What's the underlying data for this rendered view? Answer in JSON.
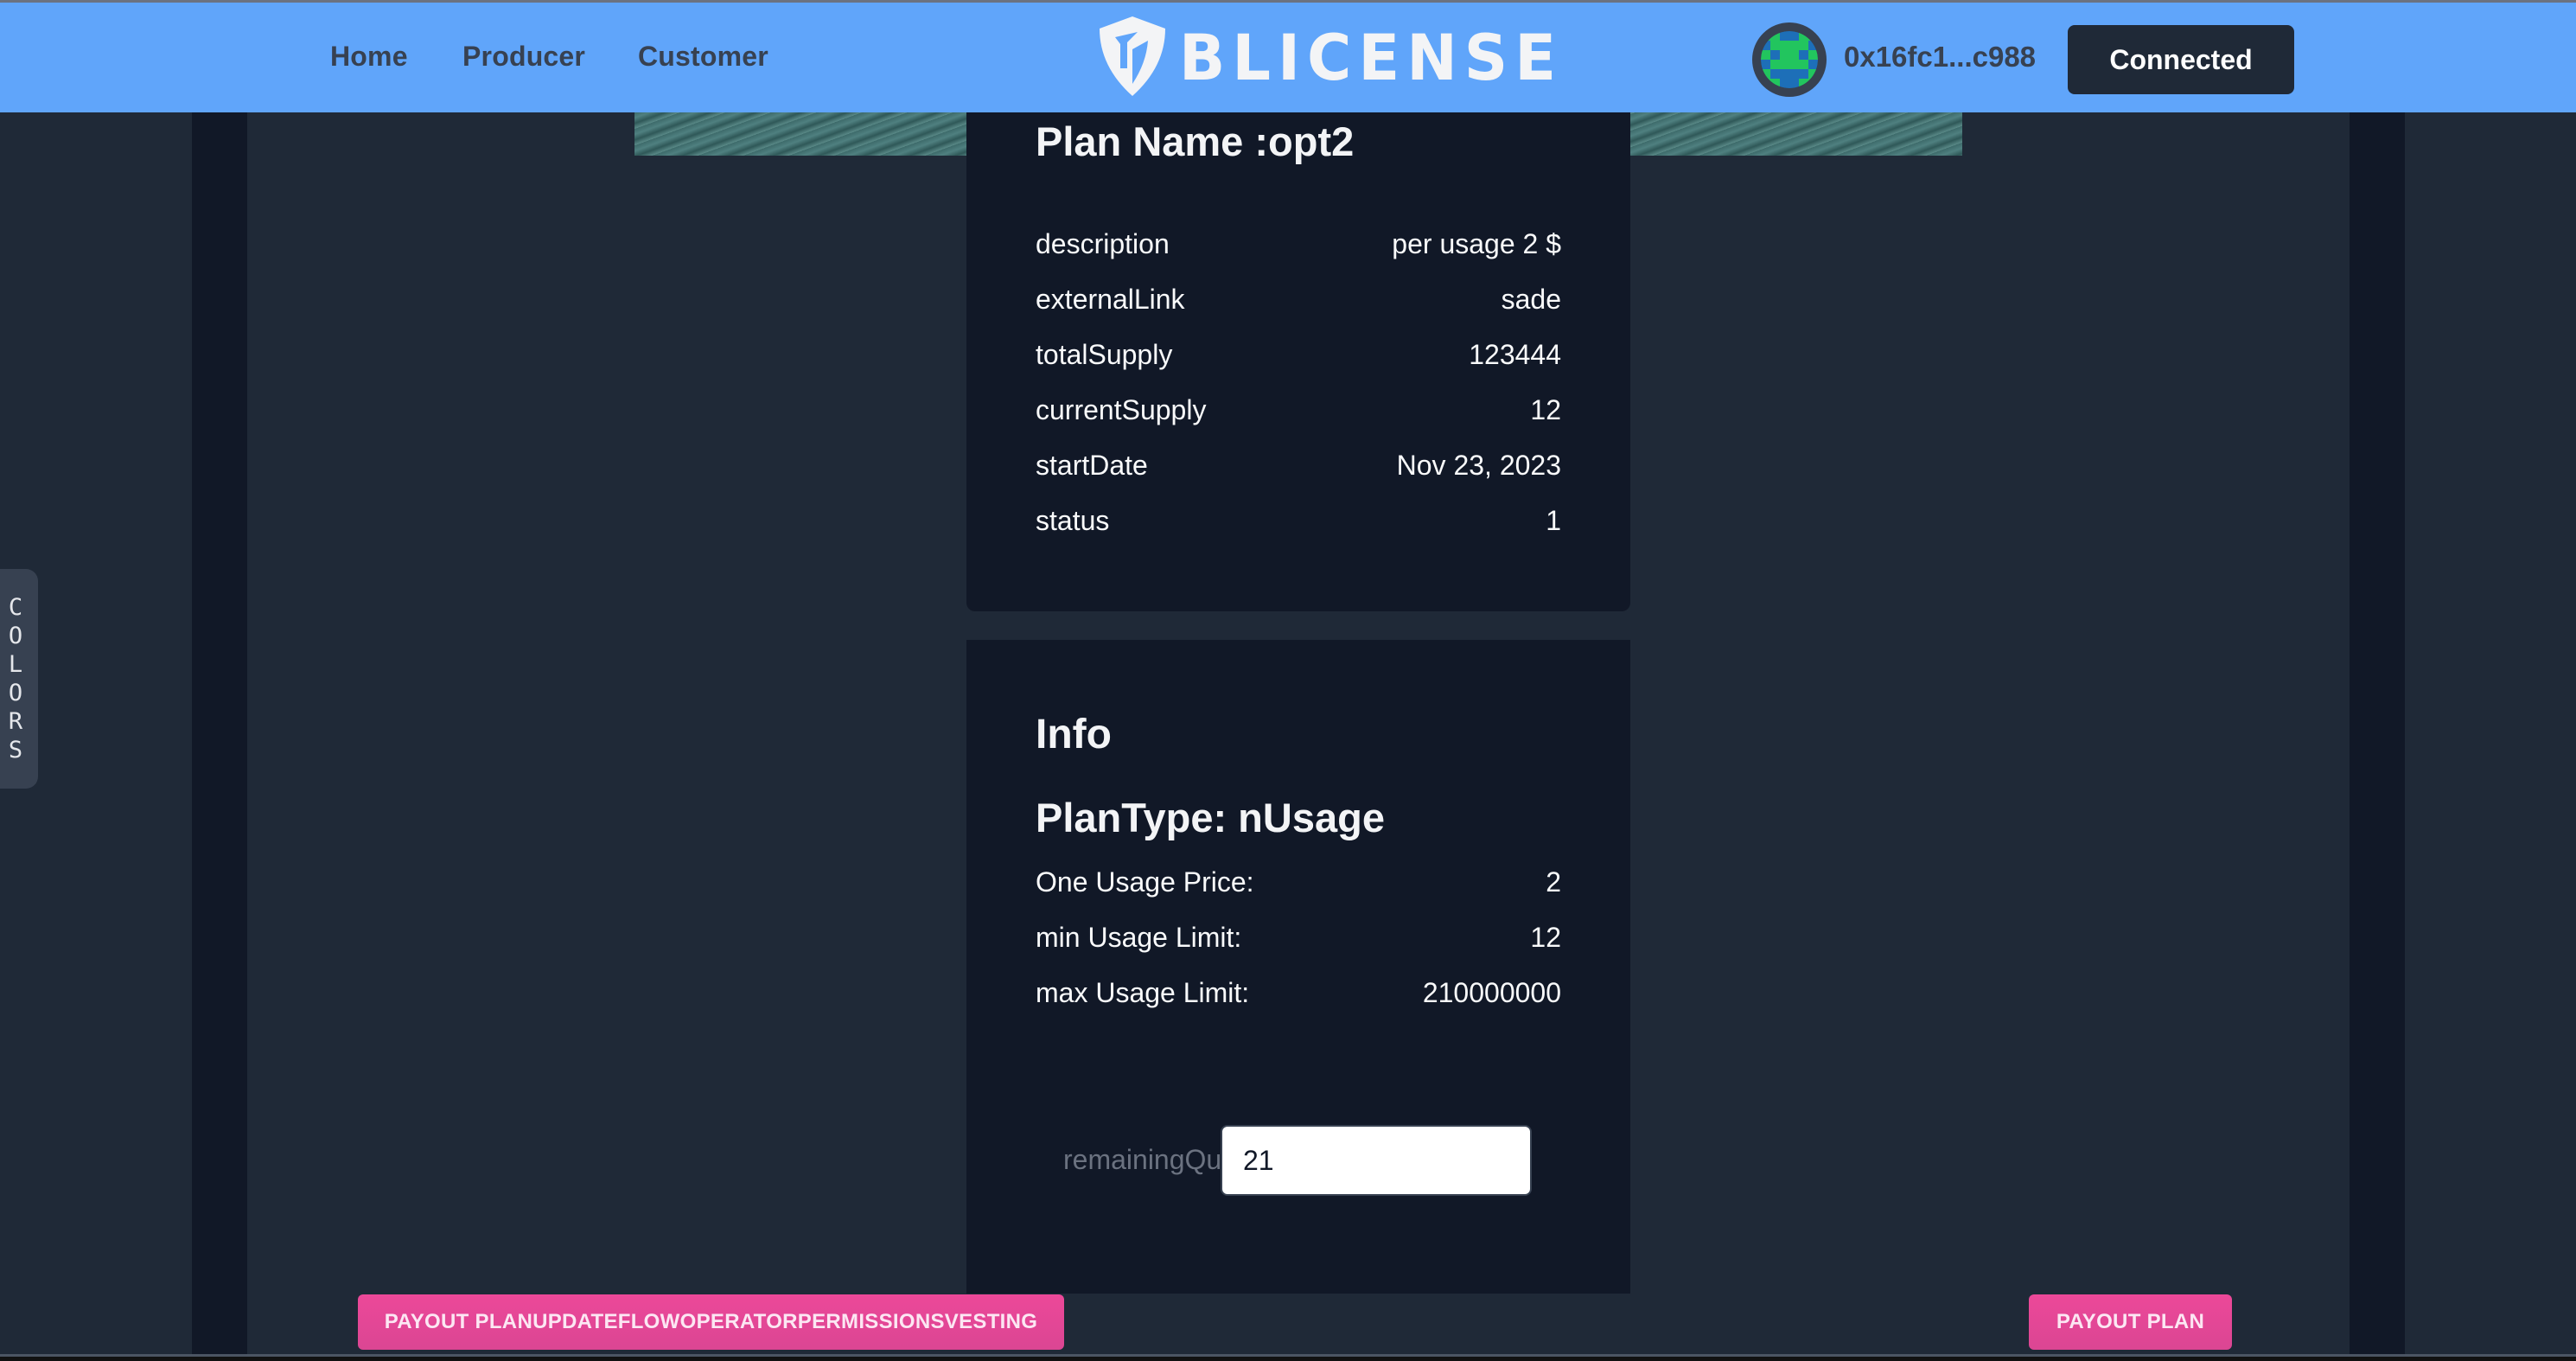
{
  "header": {
    "nav": [
      {
        "label": "Home"
      },
      {
        "label": "Producer"
      },
      {
        "label": "Customer"
      }
    ],
    "logo_text": "BLICENSE",
    "logo_icon": "shield-icon",
    "wallet_address": "0x16fc1...c988",
    "connect_label": "Connected"
  },
  "side_tab": {
    "letters": [
      "C",
      "O",
      "L",
      "O",
      "R",
      "S"
    ]
  },
  "plan_card": {
    "title": "Plan Name :opt2",
    "rows": [
      {
        "label": "description",
        "value": "per usage 2 $"
      },
      {
        "label": "externalLink",
        "value": "sade"
      },
      {
        "label": "totalSupply",
        "value": "123444"
      },
      {
        "label": "currentSupply",
        "value": "12"
      },
      {
        "label": "startDate",
        "value": "Nov 23, 2023"
      },
      {
        "label": "status",
        "value": "1"
      }
    ]
  },
  "info_card": {
    "title": "Info",
    "plan_type": "PlanType: nUsage",
    "rows": [
      {
        "label": "One Usage Price:",
        "value": "2"
      },
      {
        "label": "min Usage Limit:",
        "value": "12"
      },
      {
        "label": "max Usage Limit:",
        "value": "210000000"
      }
    ],
    "remaining_label": "remainingQuantity",
    "remaining_value": "21"
  },
  "actions": {
    "combo_label": "PAYOUT PLANUPDATEFLOWOPERATORPERMISSIONSVESTING",
    "payout_label": "PAYOUT PLAN"
  },
  "colors": {
    "navbar": "#60a5fa",
    "page_bg": "#1f2937",
    "card_bg": "#111827",
    "accent_pink": "#ec4899",
    "connect_btn": "#1f2937"
  }
}
